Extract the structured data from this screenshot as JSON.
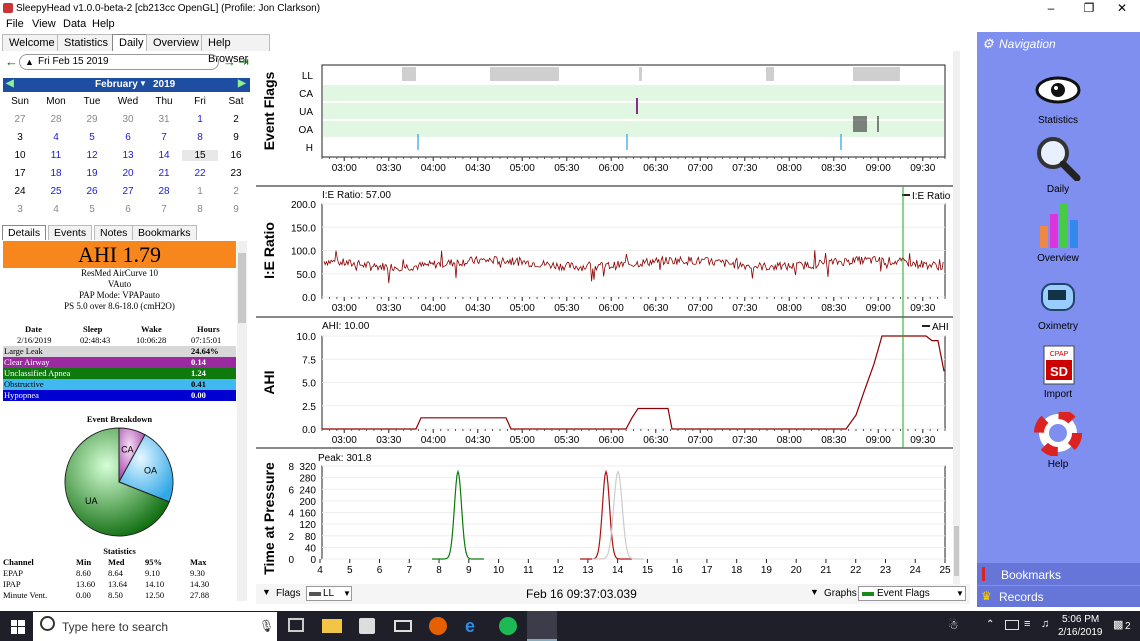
{
  "window": {
    "title": "SleepyHead v1.0.0-beta-2 [cb213cc OpenGL] (Profile: Jon Clarkson)"
  },
  "menu": [
    "File",
    "View",
    "Data",
    "Help"
  ],
  "tabs": [
    "Welcome",
    "Statistics",
    "Daily",
    "Overview",
    "Help Browser"
  ],
  "date_nav": {
    "current": "Fri Feb 15 2019",
    "month": "February",
    "year": "2019"
  },
  "calendar": {
    "weekdays": [
      "Sun",
      "Mon",
      "Tue",
      "Wed",
      "Thu",
      "Fri",
      "Sat"
    ],
    "rows": [
      [
        "27",
        "28",
        "29",
        "30",
        "31",
        "1",
        "2"
      ],
      [
        "3",
        "4",
        "5",
        "6",
        "7",
        "8",
        "9"
      ],
      [
        "10",
        "11",
        "12",
        "13",
        "14",
        "15",
        "16"
      ],
      [
        "17",
        "18",
        "19",
        "20",
        "21",
        "22",
        "23"
      ],
      [
        "24",
        "25",
        "26",
        "27",
        "28",
        "1",
        "2"
      ],
      [
        "3",
        "4",
        "5",
        "6",
        "7",
        "8",
        "9"
      ]
    ]
  },
  "side_tabs": [
    "Details",
    "Events",
    "Notes",
    "Bookmarks"
  ],
  "ahi": "AHI 1.79",
  "device": [
    "ResMed AirCurve 10",
    "VAuto",
    "PAP Mode: VPAPauto",
    "PS 5.0 over 8.6-18.0 (cmH2O)"
  ],
  "session": {
    "headers": [
      "Date",
      "Sleep",
      "Wake",
      "Hours"
    ],
    "values": [
      "2/16/2019",
      "02:48:43",
      "10:06:28",
      "07:15:01"
    ]
  },
  "events": [
    {
      "label": "Large Leak",
      "value": "24.64%",
      "color": "#d8d8d8",
      "text": "#000000"
    },
    {
      "label": "Clear Airway",
      "value": "0.14",
      "color": "#9b2aa0",
      "text": "#ffffff"
    },
    {
      "label": "Unclassified Apnea",
      "value": "1.24",
      "color": "#0e7a0e",
      "text": "#ffffff"
    },
    {
      "label": "Obstructive",
      "value": "0.41",
      "color": "#40b8f0",
      "text": "#000000"
    },
    {
      "label": "Hypopnea",
      "value": "0.00",
      "color": "#0000d0",
      "text": "#ffffff"
    }
  ],
  "breakdown": {
    "title": "Event Breakdown",
    "slices": [
      {
        "label": "CA",
        "value": 8
      },
      {
        "label": "OA",
        "value": 23
      },
      {
        "label": "UA",
        "value": 69
      }
    ]
  },
  "statistics": {
    "title": "Statistics",
    "headers": [
      "Channel",
      "Min",
      "Med",
      "95%",
      "Max"
    ],
    "rows": [
      [
        "EPAP",
        "8.60",
        "8.64",
        "9.10",
        "9.30"
      ],
      [
        "IPAP",
        "13.60",
        "13.64",
        "14.10",
        "14.30"
      ],
      [
        "Minute Vent.",
        "0.00",
        "8.50",
        "12.50",
        "27.88"
      ]
    ]
  },
  "charts": {
    "time_ticks": [
      "03:00",
      "03:30",
      "04:00",
      "04:30",
      "05:00",
      "05:30",
      "06:00",
      "06:30",
      "07:00",
      "07:30",
      "08:00",
      "08:30",
      "09:00",
      "09:30"
    ],
    "flags": {
      "title": "Event Flags",
      "rows": [
        "LL",
        "CA",
        "UA",
        "OA",
        "H"
      ]
    },
    "ie": {
      "title": "I:E Ratio",
      "label": "I:E Ratio: 57.00",
      "legend": "I:E Ratio",
      "yticks": [
        "200.0",
        "150.0",
        "100.0",
        "50.0",
        "0.0"
      ]
    },
    "ahi": {
      "title": "AHI",
      "label": "AHI: 10.00",
      "legend": "AHI",
      "yticks": [
        "10.0",
        "7.5",
        "5.0",
        "2.5",
        "0.0"
      ]
    },
    "pressure": {
      "title": "Time at Pressure",
      "label": "Peak: 301.8",
      "yticks": [
        "8",
        "6",
        "4",
        "2",
        "0"
      ],
      "yticks2": [
        "320",
        "280",
        "240",
        "200",
        "160",
        "120",
        "80",
        "40",
        "0"
      ],
      "xticks": [
        "4",
        "5",
        "6",
        "7",
        "8",
        "9",
        "10",
        "11",
        "12",
        "13",
        "14",
        "15",
        "16",
        "17",
        "18",
        "19",
        "20",
        "21",
        "22",
        "23",
        "24",
        "25"
      ]
    }
  },
  "bottom": {
    "flags_label": "Flags",
    "flag_select": "LL",
    "timestamp": "Feb 16 09:37:03.039",
    "graphs_label": "Graphs",
    "graph_select": "Event Flags"
  },
  "nav": {
    "title": "Navigation",
    "items": [
      "Statistics",
      "Daily",
      "Overview",
      "Oximetry",
      "Import",
      "Help"
    ],
    "bookmarks": "Bookmarks",
    "records": "Records"
  },
  "taskbar": {
    "search": "Type here to search",
    "time": "5:06 PM",
    "date": "2/16/2019",
    "notif": "2"
  }
}
